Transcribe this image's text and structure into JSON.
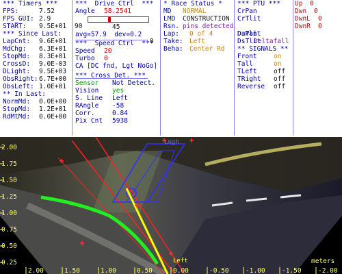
{
  "timers": {
    "header": "*** Timers ***",
    "fps_label": "FPS:",
    "fps": "7.52",
    "fps_gui_label": "FPS_GUI:",
    "fps_gui": "2.9",
    "start_label": "START:",
    "start": "9.5E+01",
    "since_header": "*** Since Last:",
    "lapcnt_label": "LapCnt:",
    "lapcnt": "9.6E+01",
    "mdchg_label": "MdChg:",
    "mdchg": "6.3E+01",
    "stopmd_label": "StopMd:",
    "stopmd": "8.3E+01",
    "crossd_label": "CrossD:",
    "crossd": "9.0E-03",
    "dlight_label": "DLight:",
    "dlight": "9.5E+03",
    "obsright_label": "ObsRight:",
    "obsright": "6.7E+00",
    "obsleft_label": "ObsLeft:",
    "obsleft": "1.0E+01",
    "inlast_header": "** In Last:",
    "normmd_label": "NormMd:",
    "normmd": "0.0E+00",
    "stopmd2_label": "StopMd:",
    "stopmd2": "1.2E+01",
    "rdmtmd_label": "RdMtMd:",
    "rdmtmd": "0.0E+00"
  },
  "drive": {
    "header": "***  Drive Ctrl  ***",
    "angle_label": "Angle",
    "angle": "58.2541",
    "slider_min": "90",
    "slider_max": "0",
    "slider_fraction": 0.35,
    "slider_value": "45",
    "avg_text": "avg=57.9  dev=0.2",
    "speed_header": "***  Speed Ctrl  ***",
    "speed_label": "Speed",
    "speed": "20",
    "turbo_label": "Turbo",
    "turbo": "0",
    "ca_text": "CA [DC fnd, Lgt NoGo]",
    "cross_header": "*** Cross Det. ***",
    "sensor_label": "Sensor",
    "sensor": "Not Detect.",
    "vision_label": "Vision",
    "vision": "yes",
    "sline_label": "S. Line",
    "sline": "Left",
    "rangle_label": "RAngle",
    "rangle": "-58",
    "corr_label": "Corr.",
    "corr": "0.84",
    "pix_label": "Pix Cnt",
    "pix": "5938"
  },
  "race": {
    "header": "* Race Status *",
    "md_label": "MD",
    "md": "NORMAL",
    "lmd_label": "LMD",
    "lmd": "CONSTRUCTION",
    "rsn_label": "Rsn.",
    "rsn": "pins detected",
    "lap_label": "Lap:",
    "lap": "0 of 4",
    "take_label": "Take:",
    "take": "Left",
    "beha_label": "Beha:",
    "beha": "Center Rd"
  },
  "ptu": {
    "header": "*** PTU ***",
    "items": [
      "CrPan",
      "CrTlit",
      "DaPan",
      "DaTlit",
      "DsTlit"
    ],
    "overlay": "Deltafall",
    "signals_header": "** SIGNALS **",
    "front_label": "Front",
    "front": "on",
    "tall_label": "Tall",
    "tall": "on",
    "tleft_label": "TLeft",
    "tleft": "off",
    "tright_label": "TRight",
    "tright": "off",
    "reverse_label": "Reverse",
    "reverse": "off"
  },
  "keys": {
    "up_label": "Up",
    "up": "0",
    "dwn_label": "Dwn",
    "dwn": "0",
    "dwnl_label": "DwnL",
    "dwnl": "0",
    "dwnr_label": "DwnR",
    "dwnr": "0"
  },
  "camera": {
    "y_ticks": [
      "2.00",
      "1.75",
      "1.50",
      "1.25",
      "1.00",
      "0.75",
      "0.50",
      "0.25",
      "0.00"
    ],
    "x_ticks": [
      "2.00",
      "1.50",
      "1.00",
      "0.50",
      "0.00",
      "-0.50",
      "-1.00",
      "-1.50",
      "-2.00"
    ],
    "units": "meters",
    "overlay_label_left": "Left",
    "overlay_label_lmgh": "Lmgh"
  }
}
